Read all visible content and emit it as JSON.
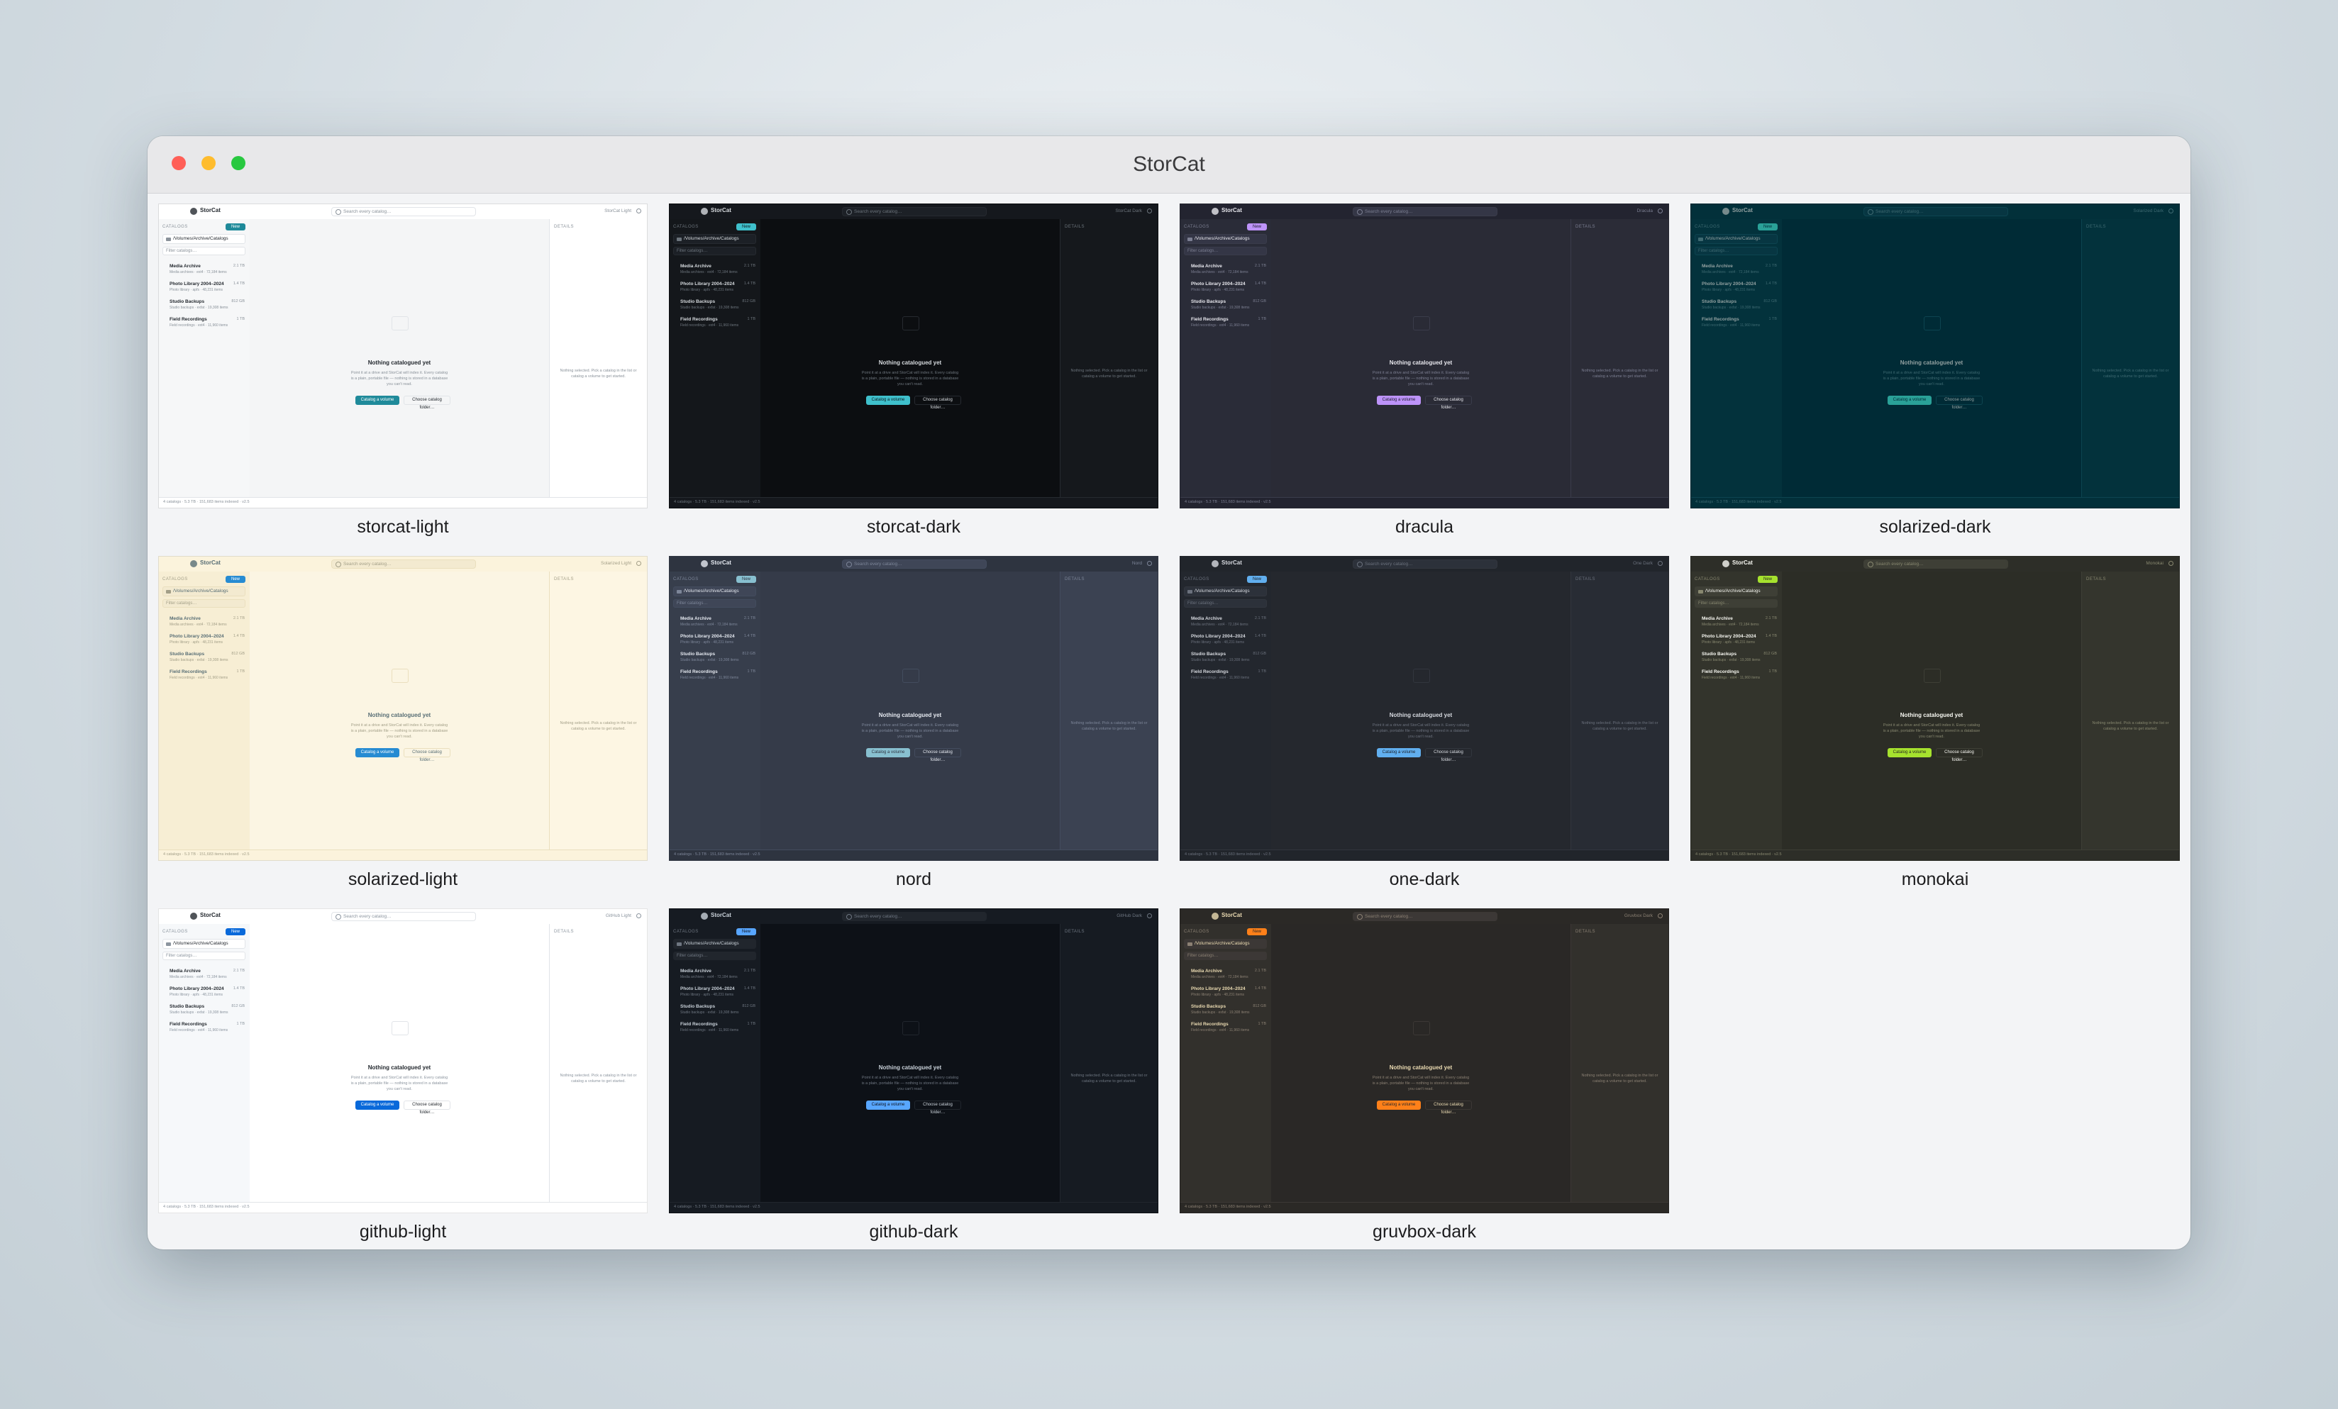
{
  "window": {
    "title": "StorCat"
  },
  "app": {
    "name": "StorCat",
    "search_placeholder": "Search every catalog…",
    "catalogs_header": "CATALOGS",
    "new_label": "New",
    "path": "/Volumes/Archive/Catalogs",
    "filter_placeholder": "Filter catalogs…",
    "volumes": [
      {
        "name": "Media Archive",
        "meta": "Media archives · ext4 · 72,184 items",
        "size": "2.1 TB"
      },
      {
        "name": "Photo Library 2004–2024",
        "meta": "Photo library · apfs · 48,231 items",
        "size": "1.4 TB"
      },
      {
        "name": "Studio Backups",
        "meta": "Studio backups · exfat · 19,308 items",
        "size": "812 GB"
      },
      {
        "name": "Field Recordings",
        "meta": "Field recordings · ext4 · 11,960 items",
        "size": "1 TB"
      }
    ],
    "empty_title": "Nothing catalogued yet",
    "empty_desc": "Point it at a drive and StorCat will index it. Every catalog is a plain, portable file — nothing is stored in a database you can't read.",
    "catalog_button": "Catalog a volume",
    "choose_button": "Choose catalog folder…",
    "details_header": "DETAILS",
    "details_text": "Nothing selected. Pick a catalog in the list or catalog a volume to get started.",
    "status": "4 catalogs · 5.3 TB · 151,683 items indexed · v2.5"
  },
  "themes": [
    {
      "label": "storcat-light",
      "theme_name": "StorCat Light",
      "colors": {
        "top": "#ffffff",
        "side": "#f6f7f8",
        "main": "#f4f5f6",
        "det": "#ffffff",
        "text": "#24292f",
        "muted": "#8a929a",
        "border": "#e1e4e8",
        "input": "#ffffff",
        "accent": "#1f8a9a",
        "btntext": "#ffffff"
      }
    },
    {
      "label": "storcat-dark",
      "theme_name": "StorCat Dark",
      "colors": {
        "top": "#15181d",
        "side": "#14171b",
        "main": "#0c0e11",
        "det": "#15181c",
        "text": "#d6dade",
        "muted": "#6c747c",
        "border": "#262a30",
        "input": "#1c2026",
        "accent": "#3fc0cc",
        "btntext": "#0c1a1e"
      }
    },
    {
      "label": "dracula",
      "theme_name": "Dracula",
      "colors": {
        "top": "#232430",
        "side": "#2a2c38",
        "main": "#2a2b36",
        "det": "#2b2c37",
        "text": "#e8e8ee",
        "muted": "#7c7f92",
        "border": "#3a3c4b",
        "input": "#343646",
        "accent": "#bd93f9",
        "btntext": "#1e1a2e"
      }
    },
    {
      "label": "solarized-dark",
      "theme_name": "Solarized Dark",
      "colors": {
        "top": "#02303a",
        "side": "#03323c",
        "main": "#002b36",
        "det": "#03323c",
        "text": "#93a1a1",
        "muted": "#3f6a72",
        "border": "#0d4450",
        "input": "#073642",
        "accent": "#2aa198",
        "btntext": "#002b36"
      }
    },
    {
      "label": "solarized-light",
      "theme_name": "Solarized Light",
      "colors": {
        "top": "#fbf3dc",
        "side": "#f7eed4",
        "main": "#fbf5e3",
        "det": "#fdf6e3",
        "text": "#586e75",
        "muted": "#a39f88",
        "border": "#eadfbe",
        "input": "#f3ead0",
        "accent": "#268bd2",
        "btntext": "#ffffff"
      }
    },
    {
      "label": "nord",
      "theme_name": "Nord",
      "colors": {
        "top": "#2e3440",
        "side": "#373e4c",
        "main": "#353b49",
        "det": "#3b4252",
        "text": "#e5e9f0",
        "muted": "#7d8699",
        "border": "#434c5e",
        "input": "#3f4657",
        "accent": "#88c0d0",
        "btntext": "#2e3440"
      }
    },
    {
      "label": "one-dark",
      "theme_name": "One Dark",
      "colors": {
        "top": "#21252b",
        "side": "#23272e",
        "main": "#25282e",
        "det": "#282c34",
        "text": "#d7dae0",
        "muted": "#6b717d",
        "border": "#32363e",
        "input": "#2c313a",
        "accent": "#61afef",
        "btntext": "#1b1f27"
      }
    },
    {
      "label": "monokai",
      "theme_name": "Monokai",
      "colors": {
        "top": "#2d2e28",
        "side": "#33342c",
        "main": "#2c2d26",
        "det": "#34352d",
        "text": "#f8f8f2",
        "muted": "#888870",
        "border": "#3e3f36",
        "input": "#3e3f36",
        "accent": "#a6e22e",
        "btntext": "#272822"
      }
    },
    {
      "label": "github-light",
      "theme_name": "GitHub Light",
      "colors": {
        "top": "#ffffff",
        "side": "#f6f8fa",
        "main": "#ffffff",
        "det": "#ffffff",
        "text": "#24292f",
        "muted": "#8c959f",
        "border": "#e1e4e8",
        "input": "#ffffff",
        "accent": "#0969da",
        "btntext": "#ffffff"
      }
    },
    {
      "label": "github-dark",
      "theme_name": "GitHub Dark",
      "colors": {
        "top": "#161b22",
        "side": "#161b22",
        "main": "#0d1117",
        "det": "#161b22",
        "text": "#c9d1d9",
        "muted": "#6e7681",
        "border": "#21262d",
        "input": "#21262d",
        "accent": "#58a6ff",
        "btntext": "#0d1117"
      }
    },
    {
      "label": "gruvbox-dark",
      "theme_name": "Gruvbox Dark",
      "colors": {
        "top": "#2b2926",
        "side": "#32302c",
        "main": "#2a2826",
        "det": "#32302c",
        "text": "#ebdbb2",
        "muted": "#8b8073",
        "border": "#3c3835",
        "input": "#3c3836",
        "accent": "#fe8019",
        "btntext": "#282828"
      }
    }
  ]
}
